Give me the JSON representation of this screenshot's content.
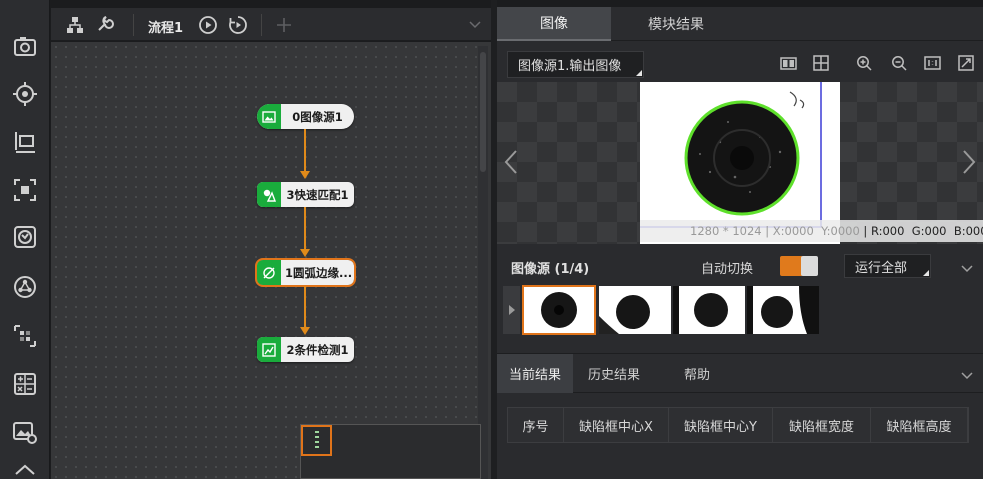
{
  "toolstrip": {
    "tools": [
      {
        "icon": "camera-icon"
      },
      {
        "icon": "crosshair-icon"
      },
      {
        "icon": "measure-icon"
      },
      {
        "icon": "focus-frame-icon"
      },
      {
        "icon": "recognition-icon"
      },
      {
        "icon": "network-icon"
      },
      {
        "icon": "calibration-icon"
      },
      {
        "icon": "calculator-icon"
      },
      {
        "icon": "image-settings-icon"
      },
      {
        "icon": "chevron-up-icon"
      }
    ]
  },
  "flow": {
    "title": "流程1",
    "nodes": [
      {
        "label": "0图像源1",
        "icon": "image-icon"
      },
      {
        "label": "3快速匹配1",
        "icon": "match-icon"
      },
      {
        "label": "1圆弧边缘...",
        "icon": "no-edge-icon"
      },
      {
        "label": "2条件检测1",
        "icon": "condition-icon"
      }
    ],
    "accent": "#e0741a",
    "node_icon_color": "#1aac3c"
  },
  "right": {
    "tabs": [
      "图像",
      "模块结果"
    ],
    "image_selector": "图像源1.输出图像",
    "pixel_info": {
      "size": "1280 * 1024",
      "x": "X:0000",
      "y": "Y:0000",
      "r": "R:000",
      "g": "G:000",
      "b": "B:000"
    },
    "source": {
      "title": "图像源 (1/4)",
      "auto_switch_label": "自动切换",
      "run_all_label": "运行全部"
    },
    "result_tabs": [
      "当前结果",
      "历史结果",
      "帮助"
    ],
    "table_columns": [
      "序号",
      "缺陷框中心X",
      "缺陷框中心Y",
      "缺陷框宽度",
      "缺陷框高度"
    ]
  }
}
